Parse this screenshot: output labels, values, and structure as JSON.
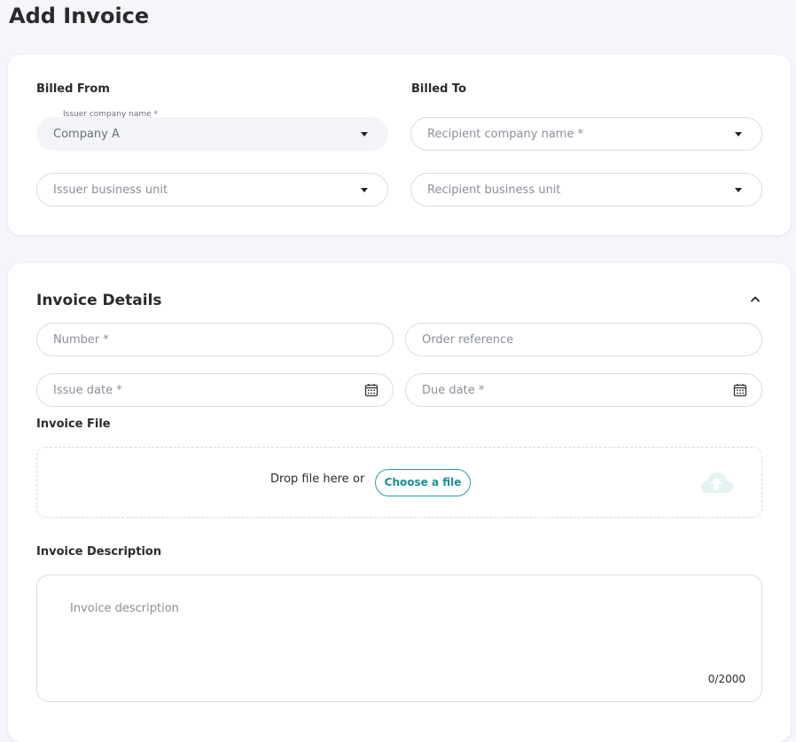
{
  "page": {
    "title": "Add Invoice"
  },
  "billing": {
    "from_label": "Billed From",
    "to_label": "Billed To",
    "issuer_company": {
      "label": "Issuer company name *",
      "value": "Company A"
    },
    "issuer_unit": {
      "placeholder": "Issuer business unit"
    },
    "recipient_company": {
      "placeholder": "Recipient company name *"
    },
    "recipient_unit": {
      "placeholder": "Recipient business unit"
    }
  },
  "details": {
    "title": "Invoice Details",
    "number": {
      "placeholder": "Number *"
    },
    "order_reference": {
      "placeholder": "Order reference"
    },
    "issue_date": {
      "placeholder": "Issue date *"
    },
    "due_date": {
      "placeholder": "Due date *"
    },
    "file_label": "Invoice File",
    "drop_text": "Drop file here",
    "or_text": "or",
    "choose_button": "Choose a file",
    "description_label": "Invoice Description",
    "description_placeholder": "Invoice description",
    "char_count": "0/2000"
  },
  "icons": {
    "dropdown": "chevron-down-icon",
    "calendar": "calendar-icon",
    "collapse": "chevron-up-icon",
    "upload": "cloud-upload-icon"
  },
  "colors": {
    "accent": "#1f8e91",
    "background": "#f5f6fb",
    "card": "#ffffff",
    "border": "#d9dbe2"
  }
}
